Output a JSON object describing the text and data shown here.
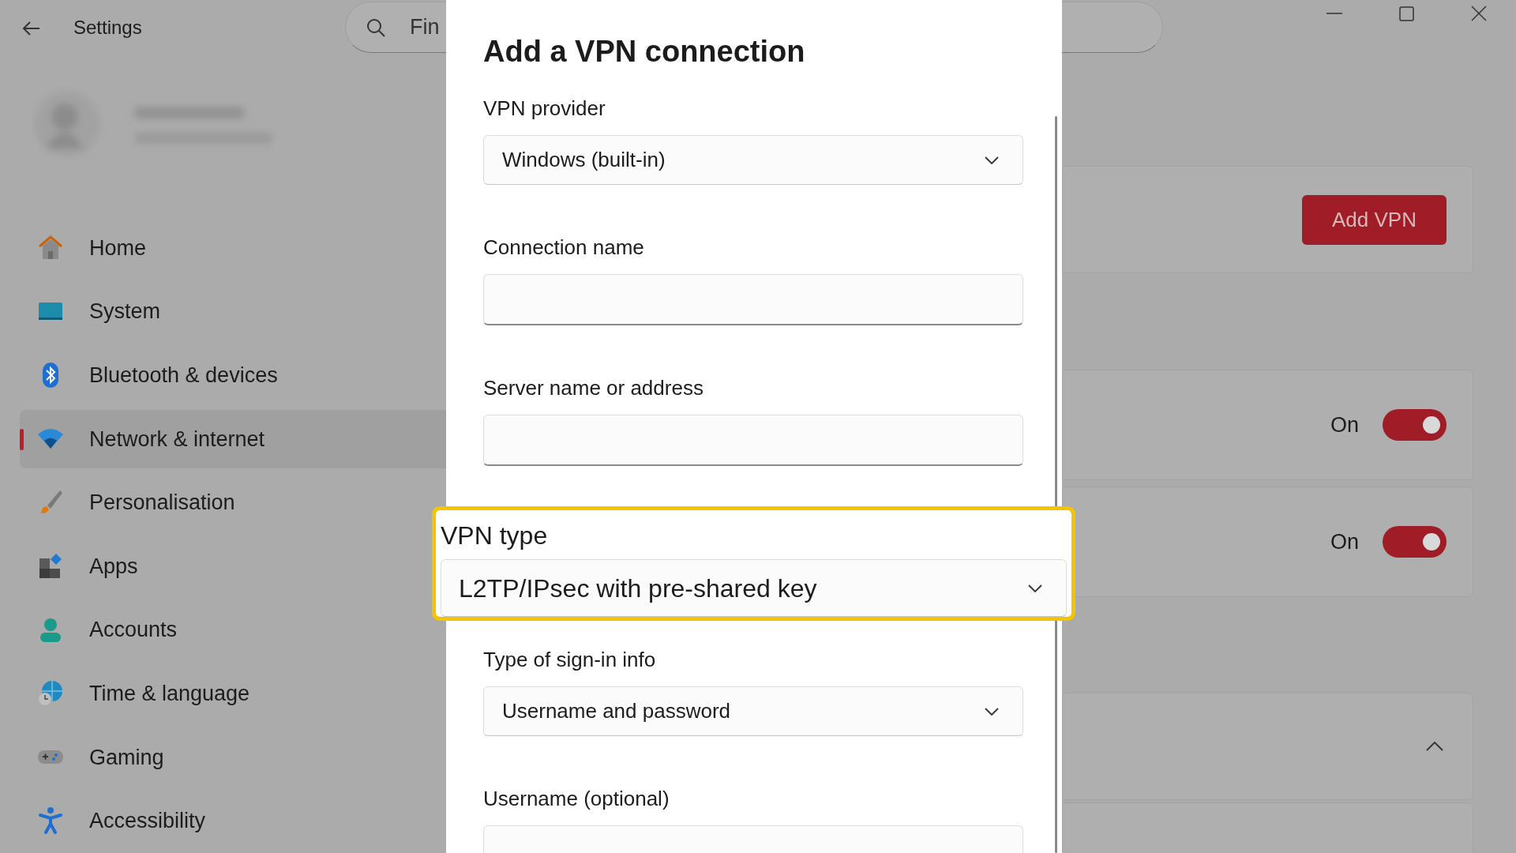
{
  "window": {
    "title": "Settings"
  },
  "search": {
    "placeholder": "Fin"
  },
  "sidebar": {
    "items": [
      {
        "label": "Home",
        "selected": false
      },
      {
        "label": "System",
        "selected": false
      },
      {
        "label": "Bluetooth & devices",
        "selected": false
      },
      {
        "label": "Network & internet",
        "selected": true
      },
      {
        "label": "Personalisation",
        "selected": false
      },
      {
        "label": "Apps",
        "selected": false
      },
      {
        "label": "Accounts",
        "selected": false
      },
      {
        "label": "Time & language",
        "selected": false
      },
      {
        "label": "Gaming",
        "selected": false
      },
      {
        "label": "Accessibility",
        "selected": false
      }
    ]
  },
  "content": {
    "cards": [
      {
        "kind": "button",
        "button": "Add VPN"
      },
      {
        "kind": "toggle",
        "state_label": "On",
        "on": true
      },
      {
        "kind": "toggle",
        "state_label": "On",
        "on": true
      },
      {
        "kind": "expander",
        "expanded": true
      },
      {
        "kind": "blank"
      }
    ]
  },
  "dialog": {
    "title": "Add a VPN connection",
    "fields": [
      {
        "label": "VPN provider",
        "kind": "dropdown",
        "value": "Windows (built-in)",
        "highlighted": false
      },
      {
        "label": "Connection name",
        "kind": "text",
        "highlighted": false
      },
      {
        "label": "Server name or address",
        "kind": "text",
        "highlighted": false
      },
      {
        "label": "VPN type",
        "kind": "dropdown",
        "value": "L2TP/IPsec with pre-shared key",
        "highlighted": true
      },
      {
        "label": "Type of sign-in info",
        "kind": "dropdown",
        "value": "Username and password",
        "highlighted": false
      },
      {
        "label": "Username (optional)",
        "kind": "text",
        "highlighted": false
      }
    ]
  }
}
